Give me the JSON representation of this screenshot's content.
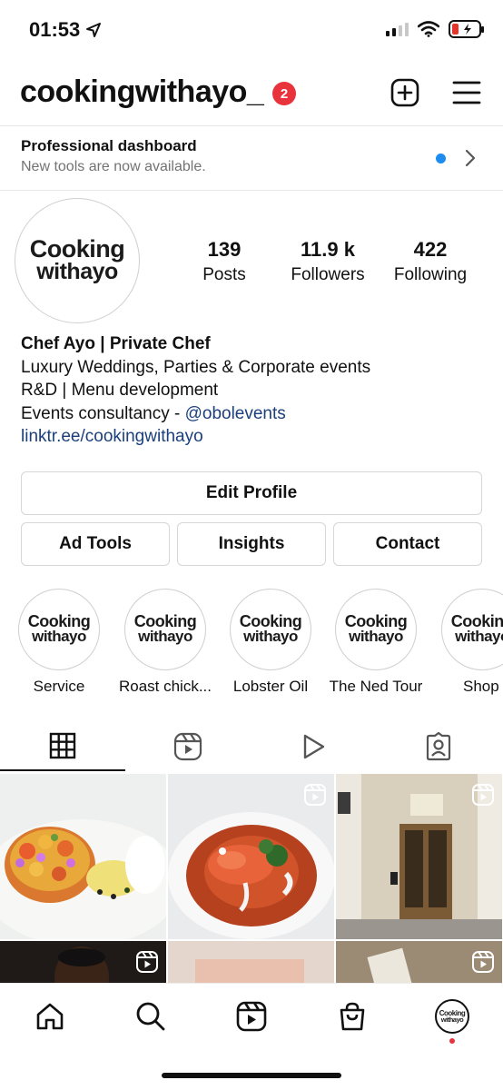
{
  "status_bar": {
    "time": "01:53"
  },
  "header": {
    "username": "cookingwithayo_",
    "notification_count": "2"
  },
  "dashboard": {
    "title": "Professional dashboard",
    "subtitle": "New tools are now available."
  },
  "logo": {
    "line1": "Cooking",
    "line2": "withayo"
  },
  "stats": {
    "posts": {
      "value": "139",
      "label": "Posts"
    },
    "followers": {
      "value": "11.9 k",
      "label": "Followers"
    },
    "following": {
      "value": "422",
      "label": "Following"
    }
  },
  "bio": {
    "name": "Chef Ayo | Private Chef",
    "line1": "Luxury Weddings, Parties & Corporate events",
    "line2": "R&D | Menu development",
    "line3_prefix": "Events consultancy - ",
    "line3_mention": "@obolevents",
    "link": "linktr.ee/cookingwithayo"
  },
  "buttons": {
    "edit_profile": "Edit Profile",
    "ad_tools": "Ad Tools",
    "insights": "Insights",
    "contact": "Contact"
  },
  "highlights": [
    {
      "label": "Service"
    },
    {
      "label": "Roast chick..."
    },
    {
      "label": "Lobster Oil"
    },
    {
      "label": "The Ned Tour"
    },
    {
      "label": "Shop"
    }
  ],
  "tabs": [
    "grid-icon",
    "reels-icon",
    "play-icon",
    "tagged-icon"
  ],
  "colors": {
    "badge_red": "#e8323c",
    "dot_blue": "#1d8cf0",
    "link_blue": "#1b3f7c",
    "muted_gray": "#737373"
  }
}
